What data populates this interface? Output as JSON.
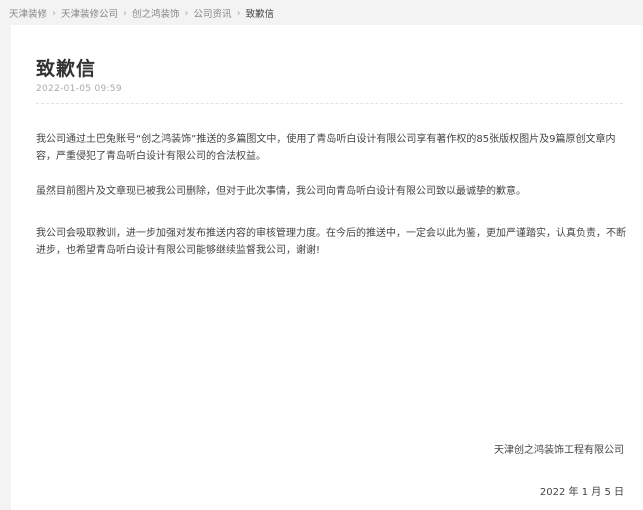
{
  "breadcrumb": {
    "items": [
      {
        "label": "天津装修"
      },
      {
        "label": "天津装修公司"
      },
      {
        "label": "创之鸿装饰"
      },
      {
        "label": "公司资讯"
      },
      {
        "label": "致歉信"
      }
    ],
    "separator": "›"
  },
  "article": {
    "title": "致歉信",
    "date": "2022-01-05 09:59",
    "paragraphs": [
      "我公司通过土巴兔账号“创之鸿装饰”推送的多篇图文中，使用了青岛听白设计有限公司享有著作权的85张版权图片及9篇原创文章内容，严重侵犯了青岛听白设计有限公司的合法权益。",
      "虽然目前图片及文章现已被我公司删除，但对于此次事情，我公司向青岛听白设计有限公司致以最诚挚的歉意。",
      "我公司会吸取教训，进一步加强对发布推送内容的审核管理力度。在今后的推送中，一定会以此为鉴，更加严谨踏实，认真负责，不断进步，也希望青岛听白设计有限公司能够继续监督我公司，谢谢!"
    ],
    "signature": "天津创之鸿装饰工程有限公司",
    "sign_date": "2022 年 1 月 5 日"
  }
}
